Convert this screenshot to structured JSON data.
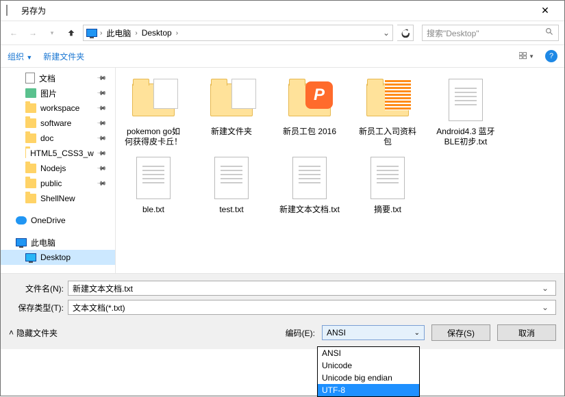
{
  "title": "另存为",
  "breadcrumb": {
    "root": "此电脑",
    "leaf": "Desktop"
  },
  "search": {
    "placeholder": "搜索\"Desktop\""
  },
  "toolbar": {
    "organize": "组织",
    "new_folder": "新建文件夹"
  },
  "sidebar": {
    "items": [
      {
        "label": "文档",
        "icon": "doc",
        "pin": true
      },
      {
        "label": "图片",
        "icon": "pic",
        "pin": true
      },
      {
        "label": "workspace",
        "icon": "folder",
        "pin": true
      },
      {
        "label": "software",
        "icon": "folder",
        "pin": true
      },
      {
        "label": "doc",
        "icon": "folder",
        "pin": true
      },
      {
        "label": "HTML5_CSS3_w",
        "icon": "folder",
        "pin": true
      },
      {
        "label": "Nodejs",
        "icon": "folder",
        "pin": true
      },
      {
        "label": "public",
        "icon": "folder",
        "pin": true
      },
      {
        "label": "ShellNew",
        "icon": "folder",
        "pin": false
      }
    ],
    "onedrive": "OneDrive",
    "this_pc": "此电脑",
    "desktop": "Desktop"
  },
  "files": [
    {
      "label": "pokemon go如何获得皮卡丘！",
      "type": "folder-doc"
    },
    {
      "label": "新建文件夹",
      "type": "folder-doc"
    },
    {
      "label": "新员工包 2016",
      "type": "folder-p"
    },
    {
      "label": "新员工入司资料包",
      "type": "folder-grid"
    },
    {
      "label": "Android4.3 蓝牙BLE初步.txt",
      "type": "txt"
    },
    {
      "label": "ble.txt",
      "type": "txt"
    },
    {
      "label": "test.txt",
      "type": "txt"
    },
    {
      "label": "新建文本文档.txt",
      "type": "txt"
    },
    {
      "label": "摘要.txt",
      "type": "txt"
    }
  ],
  "footer": {
    "filename_label": "文件名(N):",
    "filename_value": "新建文本文档.txt",
    "filetype_label": "保存类型(T):",
    "filetype_value": "文本文档(*.txt)",
    "hide_folders": "隐藏文件夹",
    "encoding_label": "编码(E):",
    "encoding_value": "ANSI",
    "save": "保存(S)",
    "cancel": "取消"
  },
  "encoding_options": [
    "ANSI",
    "Unicode",
    "Unicode big endian",
    "UTF-8"
  ],
  "encoding_highlight": "UTF-8"
}
